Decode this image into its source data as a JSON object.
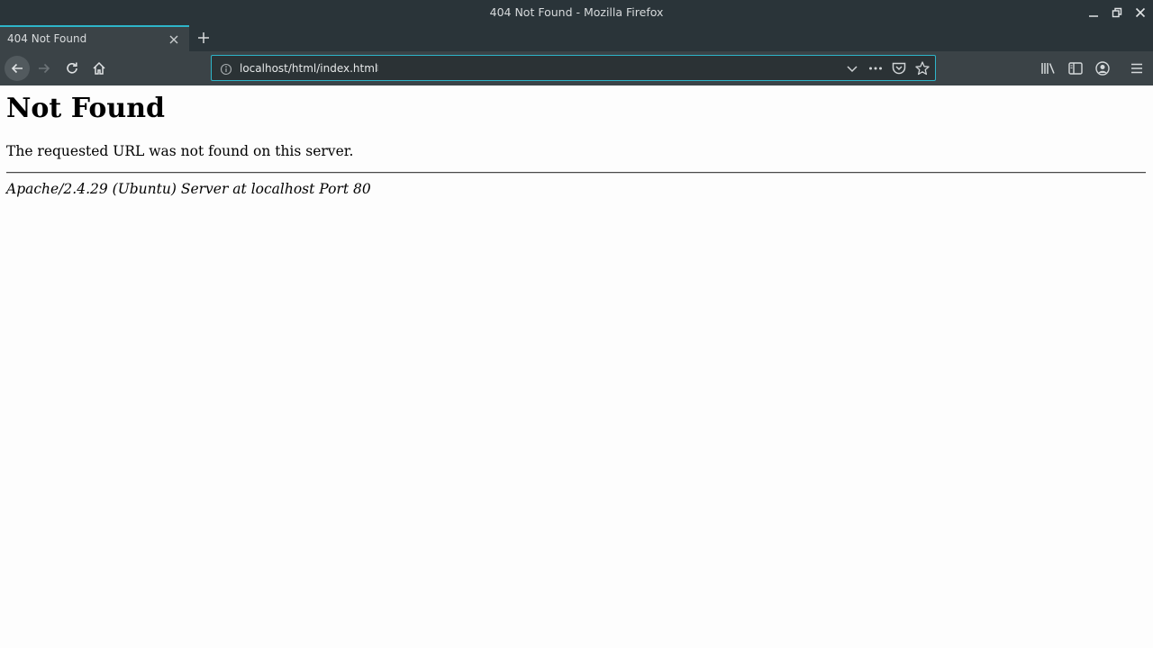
{
  "window": {
    "title": "404 Not Found - Mozilla Firefox"
  },
  "tabs": [
    {
      "title": "404 Not Found",
      "active": true
    }
  ],
  "navbar": {
    "url": "localhost/html/index.html"
  },
  "page": {
    "heading": "Not Found",
    "message": "The requested URL was not found on this server.",
    "footer": "Apache/2.4.29 (Ubuntu) Server at localhost Port 80"
  },
  "icons": {
    "window_controls": [
      "minimize-icon",
      "restore-icon",
      "close-icon"
    ],
    "nav": [
      "back-arrow-icon",
      "forward-arrow-icon",
      "reload-icon",
      "home-icon"
    ],
    "urlbar": [
      "info-icon",
      "dropdown-chevron-icon",
      "more-actions-icon",
      "pocket-icon",
      "bookmark-star-icon"
    ],
    "toolbar_right": [
      "library-icon",
      "sidebar-icon",
      "account-icon",
      "hamburger-menu-icon"
    ]
  },
  "colors": {
    "chrome_dark": "#2a3439",
    "chrome_mid": "#3b4347",
    "accent": "#2eb5c9",
    "page_bg": "#fdfdfd"
  }
}
